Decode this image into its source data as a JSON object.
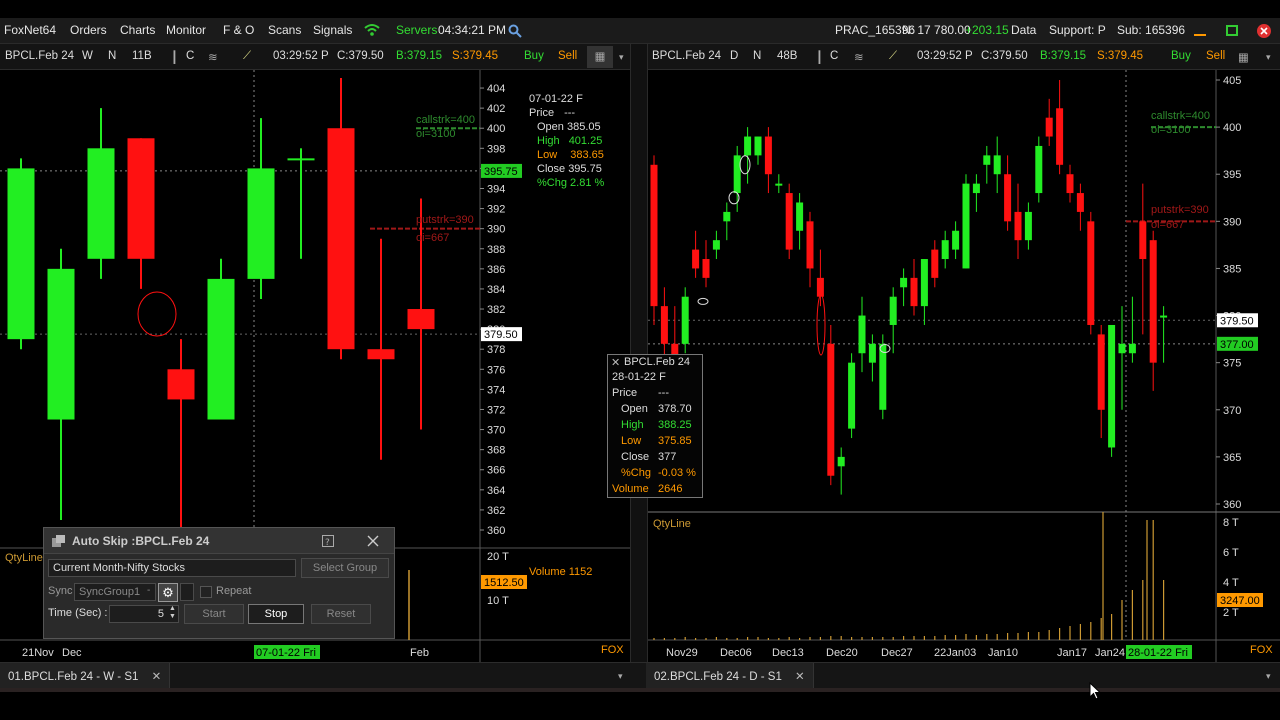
{
  "menubar": {
    "brand": "FoxNet64",
    "items": [
      "Orders",
      "Charts",
      "Monitor",
      "F & O",
      "Scans",
      "Signals"
    ],
    "servers_label": "Servers",
    "clock": "04:34:21 PM",
    "account": "PRAC_165396",
    "nifty_prefix": "N: 17 780.00",
    "nifty_change": "+203.15",
    "data_label": "Data",
    "support_label": "Support: P",
    "sub_label": "Sub: 165396"
  },
  "colors": {
    "bull": "#22ee22",
    "bear": "#ff1111",
    "buy": "#33dd33",
    "sell": "#ff9900",
    "price_tag": "#ffffff",
    "green_tag": "#22cc22",
    "orange_tag": "#ff9900",
    "grid_dash": "#888888",
    "call_strike": "#2e8b2e",
    "put_strike": "#a01818"
  },
  "left_panel": {
    "toolbar": {
      "symbol": "BPCL.Feb 24",
      "w": "W",
      "n": "N",
      "count": "11B",
      "c": "C",
      "time": "03:29:52 P",
      "close": "C:379.50",
      "bid": "B:379.15",
      "ask": "S:379.45",
      "buy": "Buy",
      "sell": "Sell"
    },
    "price_axis": [
      "404",
      "402",
      "400",
      "398",
      "396",
      "394",
      "392",
      "390",
      "388",
      "386",
      "384",
      "382",
      "380",
      "378",
      "376",
      "374",
      "372",
      "370",
      "368",
      "366",
      "364",
      "362",
      "360"
    ],
    "current_price_tag": "379.50",
    "cross_price_tag": "395.75",
    "call_strike": {
      "label": "callstrk=400",
      "oi": "oi=3100"
    },
    "put_strike": {
      "label": "putstrk=390",
      "oi": "oi=667"
    },
    "info": {
      "date": "07-01-22 F",
      "price_label": "Price",
      "price_value": "---",
      "open_label": "Open",
      "open": "385.05",
      "high_label": "High",
      "high": "401.25",
      "low_label": "Low",
      "low": "383.65",
      "close_label": "Close",
      "close": "395.75",
      "chg_label": "%Chg",
      "chg": "2.81 %"
    },
    "qty_label": "QtyLine",
    "volume_axis": [
      "20 T",
      "10 T"
    ],
    "volume_tag": "1512.50",
    "volume_text": "Volume 1152",
    "x_labels": [
      "21Nov",
      "Dec",
      "Feb"
    ],
    "x_highlight": "07-01-22 Fri",
    "fox_label": "FOX",
    "candles": [
      {
        "o": 379,
        "h": 397,
        "l": 378,
        "c": 396
      },
      {
        "o": 371,
        "h": 388,
        "l": 361,
        "c": 386
      },
      {
        "o": 387,
        "h": 402,
        "l": 385,
        "c": 398
      },
      {
        "o": 399,
        "h": 399,
        "l": 384,
        "c": 387
      },
      {
        "o": 376,
        "h": 379,
        "l": 360,
        "c": 373
      },
      {
        "o": 371,
        "h": 387,
        "l": 371,
        "c": 385
      },
      {
        "o": 385,
        "h": 401,
        "l": 383,
        "c": 396
      },
      {
        "o": 397,
        "h": 398,
        "l": 387,
        "c": 397
      },
      {
        "o": 400,
        "h": 405,
        "l": 377,
        "c": 378
      },
      {
        "o": 378,
        "h": 389,
        "l": 367,
        "c": 377
      },
      {
        "o": 382,
        "h": 393,
        "l": 370,
        "c": 380
      }
    ]
  },
  "right_panel": {
    "toolbar": {
      "symbol": "BPCL.Feb 24",
      "d": "D",
      "n": "N",
      "count": "48B",
      "c": "C",
      "time": "03:29:52 P",
      "close": "C:379.50",
      "bid": "B:379.15",
      "ask": "S:379.45",
      "buy": "Buy",
      "sell": "Sell"
    },
    "price_axis": [
      "405",
      "400",
      "395",
      "390",
      "385",
      "380",
      "375",
      "370",
      "365",
      "360"
    ],
    "current_price_tag": "379.50",
    "green_price_tag": "377.00",
    "call_strike": {
      "label": "callstrk=400",
      "oi": "oi=3100"
    },
    "put_strike": {
      "label": "putstrk=390",
      "oi": "oi=667"
    },
    "qty_label": "QtyLine",
    "volume_axis": [
      "8 T",
      "6 T",
      "4 T",
      "2 T"
    ],
    "volume_tag": "3247.00",
    "x_labels": [
      "Nov29",
      "Dec06",
      "Dec13",
      "Dec20",
      "Dec27",
      "22Jan03",
      "Jan10",
      "Jan17",
      "Jan24"
    ],
    "x_highlight": "28-01-22 Fri",
    "fox_label": "FOX",
    "candles": [
      {
        "o": 396,
        "h": 397,
        "l": 379,
        "c": 381
      },
      {
        "o": 381,
        "h": 383,
        "l": 375,
        "c": 377
      },
      {
        "o": 377,
        "h": 381,
        "l": 372,
        "c": 375
      },
      {
        "o": 377,
        "h": 383,
        "l": 376,
        "c": 382
      },
      {
        "o": 387,
        "h": 389,
        "l": 384,
        "c": 385
      },
      {
        "o": 386,
        "h": 388,
        "l": 383,
        "c": 384
      },
      {
        "o": 387,
        "h": 389,
        "l": 386,
        "c": 388
      },
      {
        "o": 390,
        "h": 392,
        "l": 388,
        "c": 391
      },
      {
        "o": 393,
        "h": 398,
        "l": 391,
        "c": 397
      },
      {
        "o": 397,
        "h": 400,
        "l": 394,
        "c": 399
      },
      {
        "o": 397,
        "h": 399,
        "l": 396,
        "c": 399
      },
      {
        "o": 399,
        "h": 400,
        "l": 393,
        "c": 395
      },
      {
        "o": 394,
        "h": 395,
        "l": 393,
        "c": 394
      },
      {
        "o": 393,
        "h": 394,
        "l": 386,
        "c": 387
      },
      {
        "o": 389,
        "h": 393,
        "l": 387,
        "c": 392
      },
      {
        "o": 390,
        "h": 391,
        "l": 383,
        "c": 385
      },
      {
        "o": 384,
        "h": 387,
        "l": 381,
        "c": 382
      },
      {
        "o": 377,
        "h": 379,
        "l": 362,
        "c": 363
      },
      {
        "o": 364,
        "h": 366,
        "l": 361,
        "c": 365
      },
      {
        "o": 368,
        "h": 376,
        "l": 367,
        "c": 375
      },
      {
        "o": 376,
        "h": 382,
        "l": 374,
        "c": 380
      },
      {
        "o": 375,
        "h": 378,
        "l": 373,
        "c": 377
      },
      {
        "o": 370,
        "h": 378,
        "l": 369,
        "c": 377
      },
      {
        "o": 379,
        "h": 383,
        "l": 376,
        "c": 382
      },
      {
        "o": 383,
        "h": 385,
        "l": 381,
        "c": 384
      },
      {
        "o": 384,
        "h": 386,
        "l": 380,
        "c": 381
      },
      {
        "o": 381,
        "h": 386,
        "l": 379,
        "c": 386
      },
      {
        "o": 387,
        "h": 388,
        "l": 383,
        "c": 384
      },
      {
        "o": 386,
        "h": 389,
        "l": 385,
        "c": 388
      },
      {
        "o": 387,
        "h": 390,
        "l": 386,
        "c": 389
      },
      {
        "o": 385,
        "h": 395,
        "l": 385,
        "c": 394
      },
      {
        "o": 393,
        "h": 395,
        "l": 391,
        "c": 394
      },
      {
        "o": 396,
        "h": 398,
        "l": 394,
        "c": 397
      },
      {
        "o": 395,
        "h": 399,
        "l": 393,
        "c": 397
      },
      {
        "o": 395,
        "h": 397,
        "l": 389,
        "c": 390
      },
      {
        "o": 391,
        "h": 394,
        "l": 386,
        "c": 388
      },
      {
        "o": 388,
        "h": 392,
        "l": 387,
        "c": 391
      },
      {
        "o": 393,
        "h": 399,
        "l": 392,
        "c": 398
      },
      {
        "o": 401,
        "h": 403,
        "l": 398,
        "c": 399
      },
      {
        "o": 402,
        "h": 405,
        "l": 395,
        "c": 396
      },
      {
        "o": 395,
        "h": 396,
        "l": 392,
        "c": 393
      },
      {
        "o": 393,
        "h": 394,
        "l": 389,
        "c": 391
      },
      {
        "o": 390,
        "h": 391,
        "l": 378,
        "c": 379
      },
      {
        "o": 378,
        "h": 379,
        "l": 367,
        "c": 370
      },
      {
        "o": 366,
        "h": 379,
        "l": 365,
        "c": 379
      },
      {
        "o": 376,
        "h": 381,
        "l": 370,
        "c": 377
      },
      {
        "o": 376,
        "h": 382,
        "l": 375,
        "c": 377
      },
      {
        "o": 390,
        "h": 394,
        "l": 378,
        "c": 386
      },
      {
        "o": 388,
        "h": 389,
        "l": 372,
        "c": 375
      },
      {
        "o": 380,
        "h": 381,
        "l": 375,
        "c": 380
      }
    ]
  },
  "tooltip": {
    "symbol": "BPCL.Feb 24",
    "date": "28-01-22 F",
    "price_label": "Price",
    "price_value": "---",
    "open_label": "Open",
    "open": "378.70",
    "high_label": "High",
    "high": "388.25",
    "low_label": "Low",
    "low": "375.85",
    "close_label": "Close",
    "close": "377",
    "chg_label": "%Chg",
    "chg": "-0.03 %",
    "volume_label": "Volume",
    "volume": "2646"
  },
  "dialog": {
    "title": "Auto Skip :BPCL.Feb 24",
    "group_value": "Current Month-Nifty Stocks",
    "select_group": "Select Group",
    "sync_label": "Sync",
    "sync_value": "SyncGroup1",
    "repeat_label": "Repeat",
    "time_label": "Time (Sec) :",
    "time_value": "5",
    "start": "Start",
    "stop": "Stop",
    "reset": "Reset"
  },
  "tabs": [
    {
      "label": "01.BPCL.Feb 24 - W - S1"
    },
    {
      "label": "02.BPCL.Feb 24 - D - S1"
    }
  ]
}
